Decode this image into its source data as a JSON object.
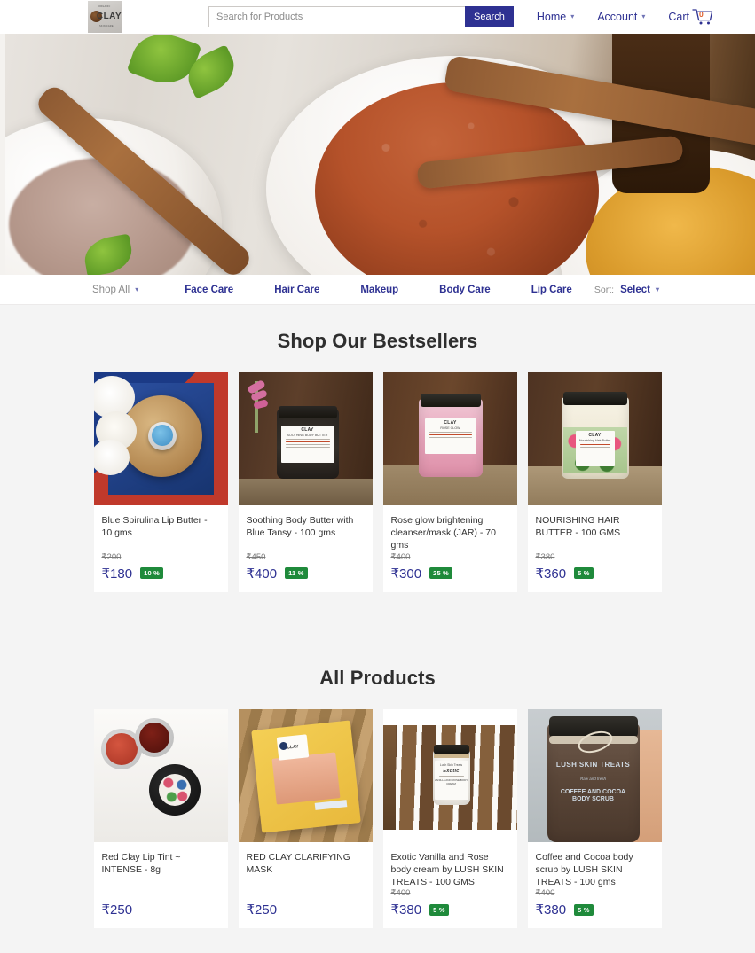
{
  "header": {
    "logo_alt": "CLAY brand logo",
    "logo_text": "CLAY",
    "logo_tagline_top": "ORGANIC",
    "logo_tagline_bottom": "SKIN CARE",
    "search": {
      "placeholder": "Search for Products",
      "value": "",
      "button_label": "Search"
    },
    "nav": [
      {
        "label": "Home",
        "has_dropdown": true
      },
      {
        "label": "Account",
        "has_dropdown": true
      }
    ],
    "cart": {
      "label": "Cart",
      "count": "0",
      "icon": "shopping-cart-icon"
    }
  },
  "hero": {
    "alt": "Clay powders in white bowls with wooden spoons and honey"
  },
  "categorybar": {
    "shop_all": "Shop All",
    "categories": [
      "Face Care",
      "Hair Care",
      "Makeup",
      "Body Care",
      "Lip Care"
    ],
    "sort_label": "Sort:",
    "sort_value": "Select"
  },
  "sections": [
    {
      "title": "Shop Our Bestsellers",
      "has_carousel": true,
      "next_icon": "chevron-right-icon",
      "products": [
        {
          "title": "Blue Spirulina Lip Butter - 10 gms",
          "old_price": "₹200",
          "price": "₹180",
          "discount": "10 %",
          "image_alt": "Blue lip butter pot on wood slice with white flowers"
        },
        {
          "title": "Soothing Body Butter with Blue Tansy - 100 gms",
          "old_price": "₹450",
          "price": "₹400",
          "discount": "11 %",
          "image_alt": "Glass jar with daisy print label on dark wood"
        },
        {
          "title": "Rose glow brightening cleanser/mask (JAR) - 70 gms",
          "old_price": "₹400",
          "price": "₹300",
          "discount": "25 %",
          "image_alt": "Pink rose petal jar on wooden table"
        },
        {
          "title": "NOURISHING HAIR BUTTER - 100 GMS",
          "old_price": "₹380",
          "price": "₹360",
          "discount": "5 %",
          "image_alt": "Cream hair butter jar with tropical floral label"
        }
      ]
    },
    {
      "title": "All Products",
      "has_carousel": false,
      "products": [
        {
          "title": "Red Clay Lip Tint ~ INTENSE - 8g",
          "old_price": "",
          "price": "₹250",
          "discount": "",
          "image_alt": "Red lip tint pots on white background"
        },
        {
          "title": "RED CLAY CLARIFYING MASK",
          "old_price": "",
          "price": "₹250",
          "discount": "",
          "image_alt": "Yellow pouch of red clay mask powder on wood"
        },
        {
          "title": "Exotic Vanilla and Rose body cream by LUSH SKIN TREATS - 100 GMS",
          "old_price": "₹400",
          "price": "₹380",
          "discount": "5 %",
          "image_alt": "Exotic vanilla and rose body cream jar in wooden crate"
        },
        {
          "title": "Coffee and Cocoa body scrub by LUSH SKIN TREATS - 100 gms",
          "old_price": "₹400",
          "price": "₹380",
          "discount": "5 %",
          "image_alt": "Hand holding Lush Skin Treats coffee and cocoa body scrub jar"
        }
      ]
    }
  ],
  "colors": {
    "brand": "#2e3192",
    "discount_badge": "#1f8a3b",
    "page_bg": "#f4f4f4",
    "card_bg": "#ffffff",
    "muted_text": "#8b8b8b"
  }
}
